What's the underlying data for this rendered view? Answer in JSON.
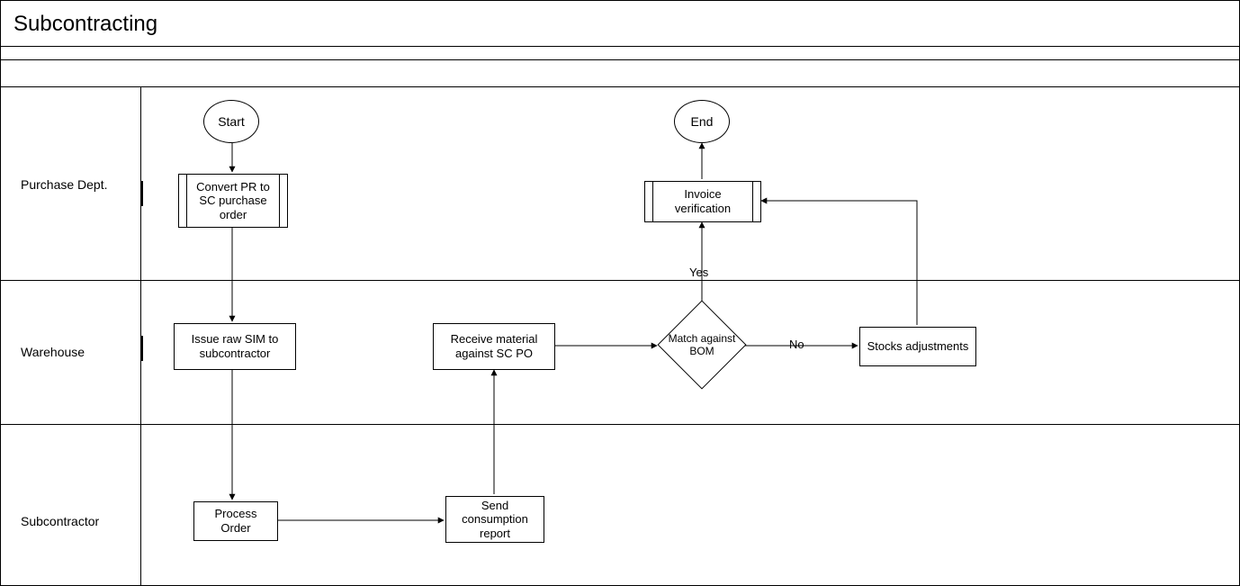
{
  "title": "Subcontracting",
  "lanes": {
    "purchase": "Purchase Dept.",
    "warehouse": "Warehouse",
    "subcontractor": "Subcontractor"
  },
  "nodes": {
    "start": "Start",
    "end": "End",
    "convert": "Convert PR to SC purchase order",
    "invoice": "Invoice verification",
    "issue": "Issue raw SIM to subcontractor",
    "receive": "Receive material against SC PO",
    "match": "Match against BOM",
    "stocks": "Stocks adjustments",
    "process": "Process Order",
    "sendreport": "Send consumption report"
  },
  "edge_labels": {
    "yes": "Yes",
    "no": "No"
  }
}
